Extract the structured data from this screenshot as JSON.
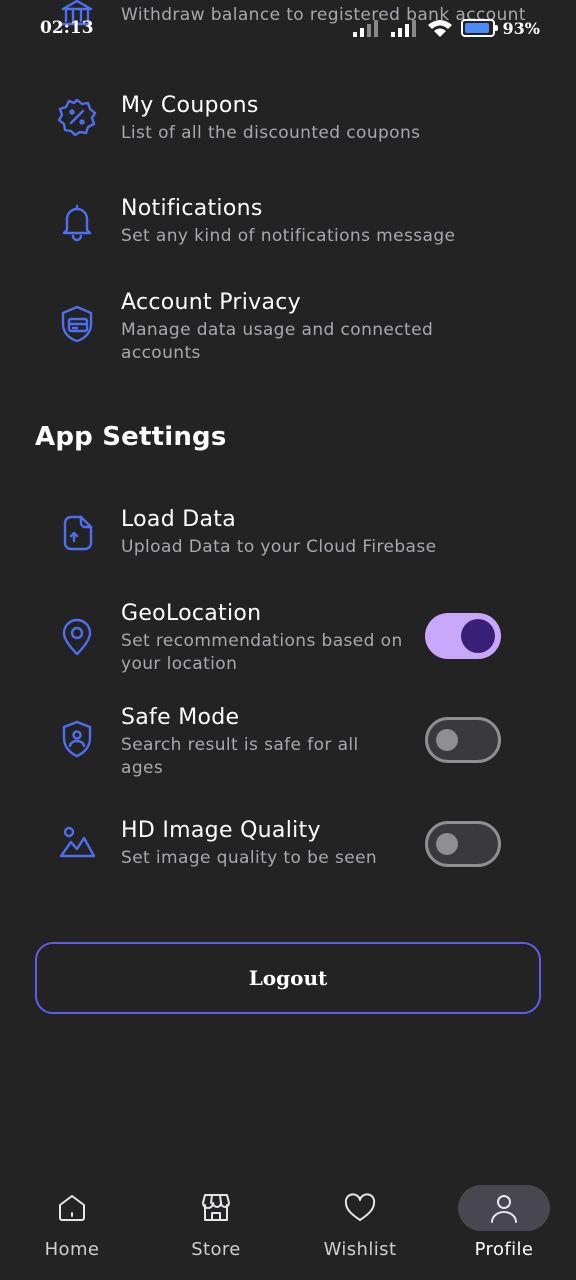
{
  "status_bar": {
    "time": "02:13",
    "battery": "93%",
    "battery_level": 0.93
  },
  "items_top": [
    {
      "title": "",
      "subtitle": "Withdraw balance to registered bank account",
      "icon": "bank-icon"
    },
    {
      "title": "My Coupons",
      "subtitle": "List of all the discounted coupons",
      "icon": "coupon-icon"
    },
    {
      "title": "Notifications",
      "subtitle": "Set any kind of notifications message",
      "icon": "bell-icon"
    },
    {
      "title": "Account Privacy",
      "subtitle": "Manage data usage and connected accounts",
      "icon": "shield-card-icon"
    }
  ],
  "app_settings": {
    "title": "App Settings",
    "items": [
      {
        "title": "Load Data",
        "subtitle": "Upload Data to your Cloud Firebase",
        "icon": "document-upload-icon"
      },
      {
        "title": "GeoLocation",
        "subtitle": "Set recommendations based on your location",
        "icon": "location-icon",
        "toggle": true
      },
      {
        "title": "Safe Mode",
        "subtitle": "Search result is safe for all ages",
        "icon": "security-user-icon",
        "toggle": false
      },
      {
        "title": "HD Image Quality",
        "subtitle": "Set image quality to be seen",
        "icon": "gallery-icon",
        "toggle": false
      }
    ]
  },
  "logout_label": "Logout",
  "bottom_nav": [
    {
      "label": "Home",
      "icon": "home-icon"
    },
    {
      "label": "Store",
      "icon": "shop-icon"
    },
    {
      "label": "Wishlist",
      "icon": "heart-icon"
    },
    {
      "label": "Profile",
      "icon": "user-icon",
      "active": true
    }
  ],
  "colors": {
    "accent": "#5b5fe6",
    "icon": "#4f6ff0",
    "toggle_on": "#c8a8fb",
    "background": "#232323"
  }
}
